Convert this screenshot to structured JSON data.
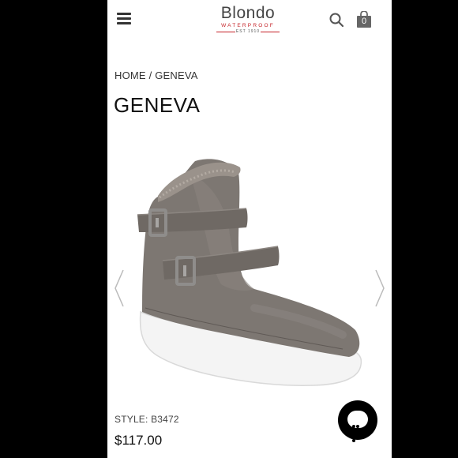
{
  "header": {
    "menu_icon": "hamburger-menu-icon",
    "logo": {
      "brand": "Blondo",
      "tagline": "WATERPROOF",
      "established": "EST 1910"
    },
    "search_icon": "search-icon",
    "cart_icon": "shopping-bag-icon",
    "cart_count": "0"
  },
  "breadcrumb": {
    "home": "HOME",
    "separator": " / ",
    "current": "GENEVA"
  },
  "product": {
    "title": "GENEVA",
    "image_alt_icon": "gray-suede-buckle-bootie",
    "style": "STYLE: B3472",
    "price": "$117.00"
  },
  "carousel": {
    "prev_icon": "chevron-left-icon",
    "next_icon": "chevron-right-icon"
  },
  "chat": {
    "icon": "chat-bubble-icon"
  },
  "colors": {
    "background": "#000000",
    "page": "#ffffff",
    "brand_red": "#c42026",
    "boot_gray": "#7d7772"
  }
}
